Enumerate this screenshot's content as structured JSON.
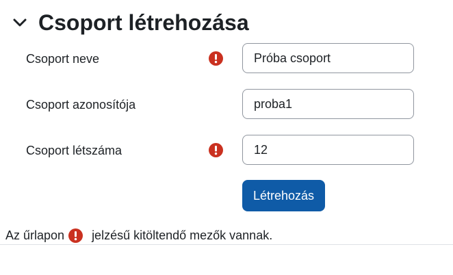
{
  "section": {
    "title": "Csoport létrehozása",
    "toggle_icon": "chevron-down-icon"
  },
  "form": {
    "fields": [
      {
        "label": "Csoport neve",
        "value": "Próba csoport",
        "required": true
      },
      {
        "label": "Csoport azonosítója",
        "value": "proba1",
        "required": false
      },
      {
        "label": "Csoport létszáma",
        "value": "12",
        "required": true
      }
    ],
    "submit_label": "Létrehozás"
  },
  "footer": {
    "note_before": "Az űrlapon",
    "note_after": "jelzésű kitöltendő mezők vannak."
  },
  "colors": {
    "primary_button": "#0f5ba7",
    "required_icon": "#ca3120",
    "text": "#1d2125",
    "input_border": "#8f959e"
  }
}
